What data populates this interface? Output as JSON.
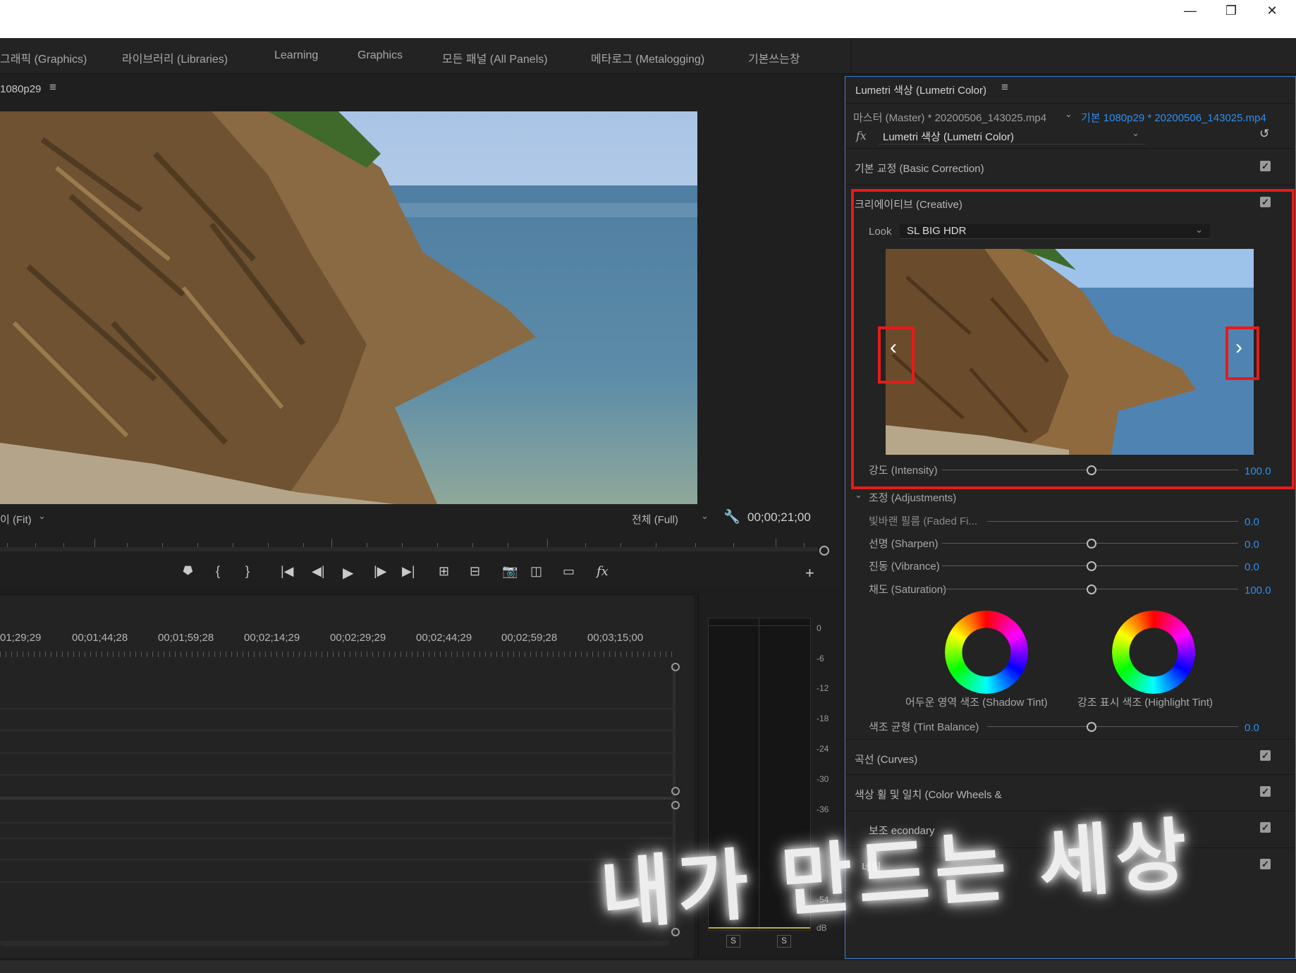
{
  "window": {
    "minimize": "—",
    "restore": "❐",
    "close": "✕"
  },
  "workspace_tabs": [
    "그래픽 (Graphics)",
    "라이브러리 (Libraries)",
    "Learning",
    "Graphics",
    "모든 패널 (All Panels)",
    "메타로그 (Metalogging)",
    "기본쓰는창"
  ],
  "program_monitor": {
    "sequence_name": "1080p29",
    "zoom_label": "이 (Fit)",
    "resolution_label": "전체 (Full)",
    "timecode": "00;00;21;00"
  },
  "timeline": {
    "timecodes": [
      "01;29;29",
      "00;01;44;28",
      "00;01;59;28",
      "00;02;14;29",
      "00;02;29;29",
      "00;02;44;29",
      "00;02;59;28",
      "00;03;15;00"
    ]
  },
  "audio_meter": {
    "scale": [
      "0",
      "-6",
      "-12",
      "-18",
      "-24",
      "-30",
      "-36",
      "-54",
      "dB"
    ],
    "solo_labels": [
      "S",
      "S"
    ]
  },
  "lumetri": {
    "panel_title": "Lumetri 색상 (Lumetri Color)",
    "master_clip": "마스터 (Master) * 20200506_143025.mp4",
    "sequence_clip": "기본 1080p29 * 20200506_143025.mp4",
    "fx_label": "fx",
    "effect_select": "Lumetri 색상 (Lumetri Color)",
    "sections": {
      "basic": "기본 교정 (Basic Correction)",
      "creative": "크리에이티브 (Creative)",
      "curves": "곡선 (Curves)",
      "wheels": "색상 휠 및 일치 (Color Wheels &",
      "secondary": "보조 econdary",
      "vignette": "네팅"
    },
    "creative": {
      "look_label": "Look",
      "look_value": "SL BIG HDR",
      "intensity_label": "강도 (Intensity)",
      "intensity_value": "100.0",
      "intensity": 100,
      "adjustments_label": "조정 (Adjustments)",
      "faded_label": "빛바랜 필름 (Faded Fi...",
      "faded_value": "0.0",
      "sharpen_label": "선명 (Sharpen)",
      "sharpen_value": "0.0",
      "vibrance_label": "진동 (Vibrance)",
      "vibrance_value": "0.0",
      "saturation_label": "채도 (Saturation)",
      "saturation_value": "100.0",
      "shadow_tint_label": "어두운 영역 색조 (Shadow Tint)",
      "highlight_tint_label": "강조 표시 색조 (Highlight Tint)",
      "tint_balance_label": "색조 균형 (Tint Balance)",
      "tint_balance_value": "0.0"
    }
  },
  "watermark": "내가 만드는 세상",
  "colors": {
    "accent_blue": "#2f8ef0",
    "highlight_red": "#e81a1a",
    "panel_border": "#3d7fd0"
  }
}
